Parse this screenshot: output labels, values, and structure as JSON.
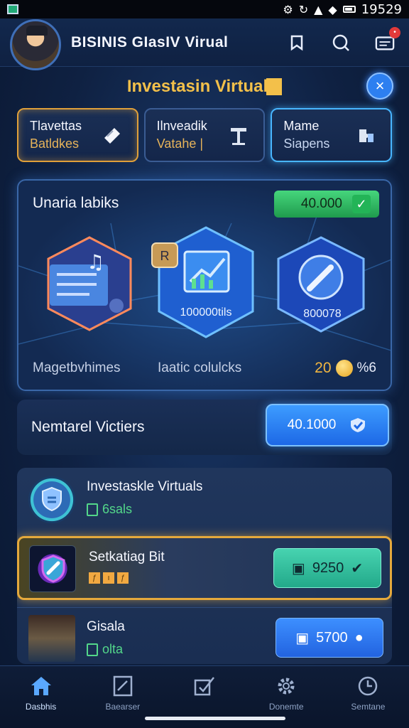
{
  "status_bar": {
    "time": "19529"
  },
  "header": {
    "app_title": "BISINIS GIasIV Virual"
  },
  "page": {
    "title": "Investasin Virtual",
    "close_label": "×"
  },
  "tabs": [
    {
      "title": "Tlavettas",
      "subtitle": "Batldkes"
    },
    {
      "title": "Ilnveadik",
      "subtitle": "Vatahe |"
    },
    {
      "title": "Mame",
      "subtitle": "Siapens"
    }
  ],
  "featured": {
    "title": "Unaria labiks",
    "pill_value": "40.000",
    "hex_center_label": "100000tils",
    "hex_right_label": "800078",
    "hex_badge": "R",
    "footer_left": "Magetbvhimes",
    "footer_mid": "Iaatic colulcks",
    "footer_num": "20",
    "footer_pct": "%6"
  },
  "section": {
    "title": "Nemtarel Victiers",
    "button_value": "40.1000"
  },
  "list": [
    {
      "name": "Investaskle Virtuals",
      "meta": "6sals"
    },
    {
      "name": "Setkatiag Bit",
      "meta": "",
      "button_value": "9250"
    },
    {
      "name": "Gisala",
      "meta": "olta",
      "button_value": "5700"
    }
  ],
  "bottom_nav": [
    {
      "label": "Dasbhis",
      "icon": "home-icon"
    },
    {
      "label": "Baearser",
      "icon": "document-icon"
    },
    {
      "label": "",
      "icon": "edit-check-icon"
    },
    {
      "label": "Donemte",
      "icon": "settings-gear-icon"
    },
    {
      "label": "Semtane",
      "icon": "clock-icon"
    }
  ],
  "colors": {
    "accent_blue": "#2d7ff0",
    "accent_gold": "#f3c04a",
    "accent_green": "#46d67c"
  }
}
